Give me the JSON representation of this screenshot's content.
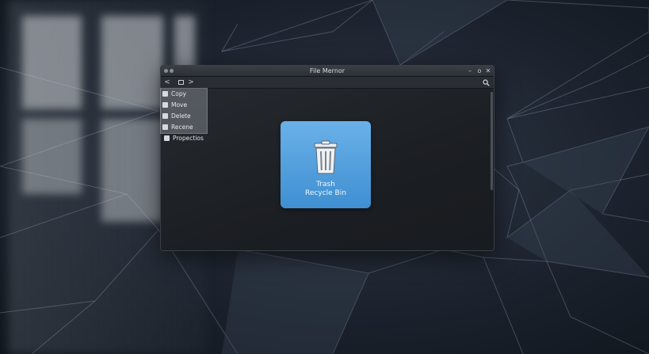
{
  "window": {
    "title": "File Mernor",
    "controls": {
      "minimize": "–",
      "maximize": "o",
      "close": "✕"
    }
  },
  "toolbar": {
    "back": "<",
    "forward": ">"
  },
  "context_menu": {
    "items": [
      {
        "label": "Copy",
        "icon": "copy-icon"
      },
      {
        "label": "Move",
        "icon": "move-icon"
      },
      {
        "label": "Delete",
        "icon": "delete-icon"
      },
      {
        "label": "Recene",
        "icon": "rename-icon"
      },
      {
        "label": "Propectios",
        "icon": "properties-icon"
      }
    ]
  },
  "item": {
    "name_line1": "Trash",
    "name_line2": "Recycle Bin",
    "icon": "trash-icon",
    "tile_color": "#4f9fdc"
  }
}
